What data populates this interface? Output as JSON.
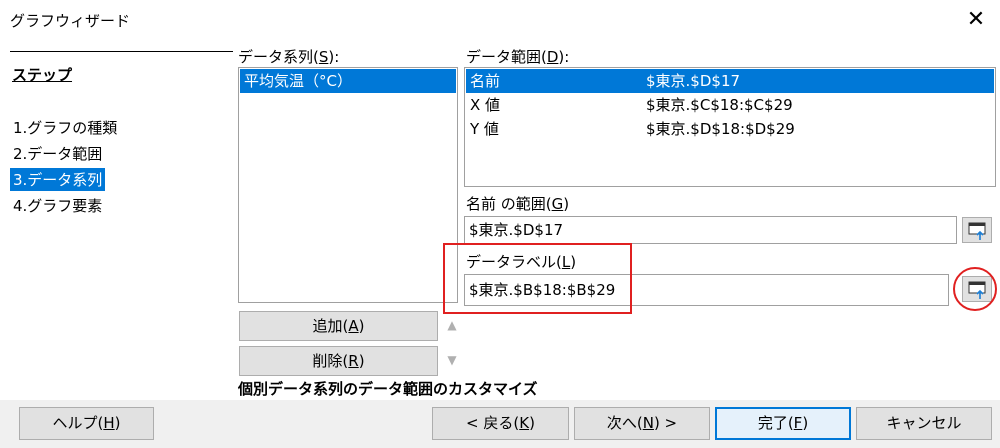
{
  "window": {
    "title": "グラフウィザード"
  },
  "steps": {
    "heading": "ステップ",
    "items": [
      {
        "label": "1.グラフの種類"
      },
      {
        "label": "2.データ範囲"
      },
      {
        "label": "3.データ系列",
        "selected": true
      },
      {
        "label": "4.グラフ要素"
      }
    ]
  },
  "series": {
    "label_main": "データ系列(",
    "label_key": "S",
    "label_end": "):",
    "items": [
      "平均気温（°C）"
    ]
  },
  "ranges": {
    "label_main": "データ範囲(",
    "label_key": "D",
    "label_end": "):",
    "rows": [
      {
        "name": "名前",
        "value": "$東京.$D$17"
      },
      {
        "name": "X 値",
        "value": "$東京.$C$18:$C$29"
      },
      {
        "name": "Y 値",
        "value": "$東京.$D$18:$D$29"
      }
    ]
  },
  "name_range": {
    "label_main": "名前 の範囲(",
    "label_key": "G",
    "label_end": ")",
    "value": "$東京.$D$17"
  },
  "data_label": {
    "label_main": "データラベル(",
    "label_key": "L",
    "label_end": ")",
    "value": "$東京.$B$18:$B$29"
  },
  "buttons": {
    "add": {
      "main": "追加(",
      "key": "A",
      "end": ")"
    },
    "delete": {
      "main": "削除(",
      "key": "R",
      "end": ")"
    }
  },
  "hint": "個別データ系列のデータ範囲のカスタマイズ",
  "footer": {
    "help": {
      "main": "ヘルプ(",
      "key": "H",
      "end": ")"
    },
    "back": {
      "main": "< 戻る(",
      "key": "K",
      "end": ")"
    },
    "next": {
      "main": "次へ(",
      "key": "N",
      "end": ") >"
    },
    "finish": {
      "main": "完了(",
      "key": "F",
      "end": ")"
    },
    "cancel": "キャンセル"
  },
  "colors": {
    "selection": "#0078d7",
    "annotation": "#e02020"
  }
}
